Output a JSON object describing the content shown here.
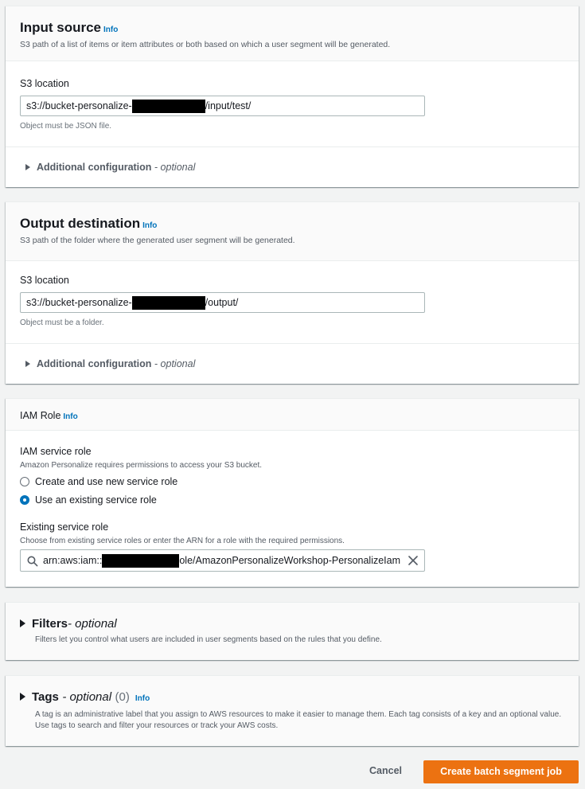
{
  "input_source": {
    "title": "Input source",
    "info": "Info",
    "description": "S3 path of a list of items or item attributes or both based on which a user segment will be generated.",
    "s3_label": "S3 location",
    "s3_prefix": "s3://bucket-personalize-",
    "s3_suffix": "/input/test/",
    "s3_hint": "Object must be JSON file.",
    "additional_config": "Additional configuration",
    "additional_optional": "- optional"
  },
  "output_destination": {
    "title": "Output destination",
    "info": "Info",
    "description": "S3 path of the folder where the generated user segment will be generated.",
    "s3_label": "S3 location",
    "s3_prefix": "s3://bucket-personalize-",
    "s3_suffix": "/output/",
    "s3_hint": "Object must be a folder.",
    "additional_config": "Additional configuration",
    "additional_optional": "- optional"
  },
  "iam_role": {
    "title": "IAM Role",
    "info": "Info",
    "service_role_label": "IAM service role",
    "service_role_desc": "Amazon Personalize requires permissions to access your S3 bucket.",
    "option_create": "Create and use new service role",
    "option_existing": "Use an existing service role",
    "selected_option": "existing",
    "existing_label": "Existing service role",
    "existing_desc": "Choose from existing service roles or enter the ARN for a role with the required permissions.",
    "arn_prefix": "arn:aws:iam::",
    "arn_suffix": "ole/AmazonPersonalizeWorkshop-PersonalizeIam"
  },
  "filters": {
    "title": "Filters",
    "optional": "- optional",
    "description": "Filters let you control what users are included in user segments based on the rules that you define."
  },
  "tags": {
    "title": "Tags",
    "optional": "- optional",
    "count": "(0)",
    "info": "Info",
    "description": "A tag is an administrative label that you assign to AWS resources to make it easier to manage them. Each tag consists of a key and an optional value. Use tags to search and filter your resources or track your AWS costs."
  },
  "actions": {
    "cancel": "Cancel",
    "create": "Create batch segment job"
  },
  "colors": {
    "primary": "#ec7211",
    "link": "#0073bb",
    "background": "#f2f3f3"
  }
}
